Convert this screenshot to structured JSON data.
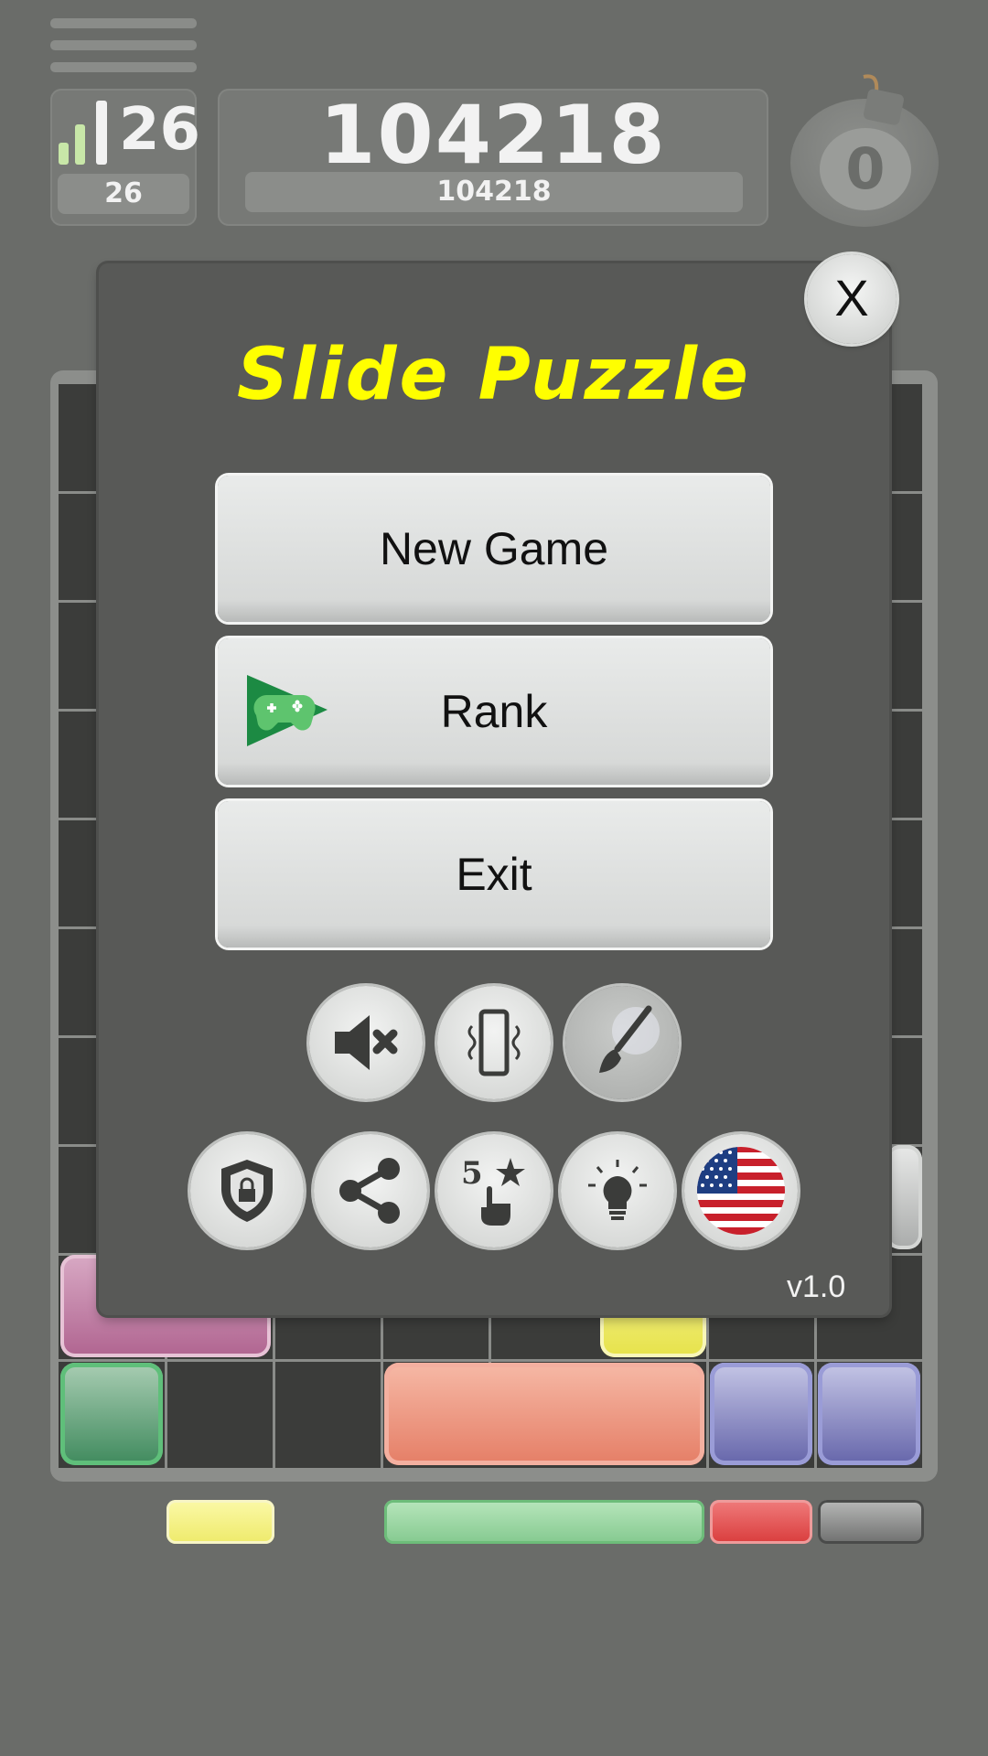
{
  "header": {
    "level": "26",
    "level_sub": "26",
    "score": "104218",
    "score_sub": "104218",
    "bomb_count": "0"
  },
  "dialog": {
    "title": "Slide Puzzle",
    "buttons": [
      "New Game",
      "Rank",
      "Exit"
    ],
    "close_label": "X",
    "version": "v1.0"
  },
  "icons": {
    "row1": [
      "sound-muted-icon",
      "vibration-icon",
      "theme-brush-icon"
    ],
    "row2": [
      "privacy-shield-icon",
      "share-icon",
      "rate-5-stars-icon",
      "hint-lightbulb-icon",
      "language-us-flag-icon"
    ]
  },
  "colors": {
    "title": "#ffff00",
    "background": "#6a6c69",
    "dialog": "#585957",
    "board": "#3b3c3a"
  }
}
